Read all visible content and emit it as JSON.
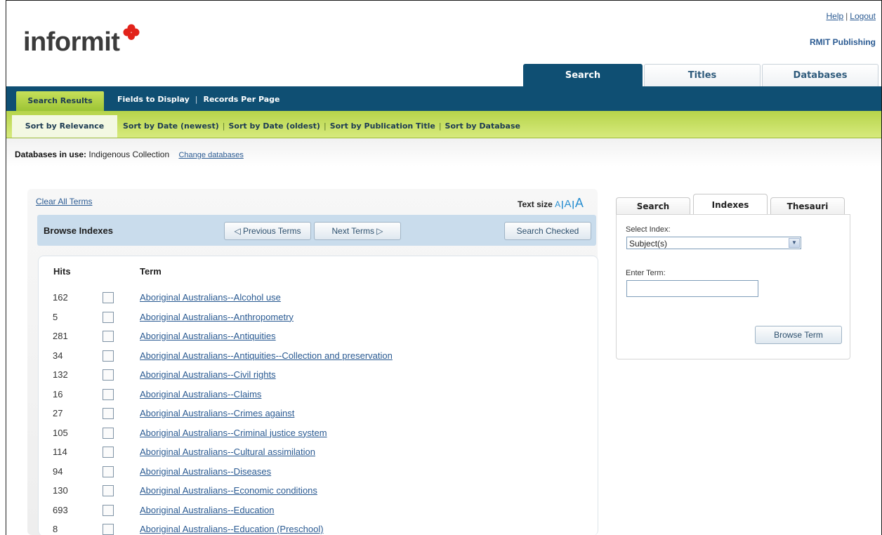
{
  "header": {
    "logo_text": "informit",
    "help": "Help",
    "logout": "Logout",
    "sep": "|",
    "publisher": "RMIT Publishing"
  },
  "main_tabs": [
    "Search",
    "Titles",
    "Databases"
  ],
  "nav": {
    "active": "Search Results",
    "fields": "Fields to Display",
    "records": "Records Per Page"
  },
  "sort": {
    "active": "Sort by Relevance",
    "date_newest": "Sort by Date (newest)",
    "date_oldest": "Sort by Date (oldest)",
    "pub_title": "Sort by Publication Title",
    "database": "Sort by Database"
  },
  "databases": {
    "label": "Databases in use:",
    "value": "Indigenous Collection",
    "change": "Change databases"
  },
  "browse": {
    "clear_terms": "Clear All Terms",
    "text_size_label": "Text size",
    "size_a": "A",
    "title": "Browse Indexes",
    "prev": "◁ Previous Terms",
    "next": "Next Terms ▷",
    "search_checked": "Search Checked",
    "col_hits": "Hits",
    "col_term": "Term",
    "rows": [
      {
        "hits": "162",
        "term": "Aboriginal Australians--Alcohol use"
      },
      {
        "hits": "5",
        "term": "Aboriginal Australians--Anthropometry"
      },
      {
        "hits": "281",
        "term": "Aboriginal Australians--Antiquities"
      },
      {
        "hits": "34",
        "term": "Aboriginal Australians--Antiquities--Collection and preservation"
      },
      {
        "hits": "132",
        "term": "Aboriginal Australians--Civil rights"
      },
      {
        "hits": "16",
        "term": "Aboriginal Australians--Claims"
      },
      {
        "hits": "27",
        "term": "Aboriginal Australians--Crimes against"
      },
      {
        "hits": "105",
        "term": "Aboriginal Australians--Criminal justice system"
      },
      {
        "hits": "114",
        "term": "Aboriginal Australians--Cultural assimilation"
      },
      {
        "hits": "94",
        "term": "Aboriginal Australians--Diseases"
      },
      {
        "hits": "130",
        "term": "Aboriginal Australians--Economic conditions"
      },
      {
        "hits": "693",
        "term": "Aboriginal Australians--Education"
      },
      {
        "hits": "8",
        "term": "Aboriginal Australians--Education (Preschool)"
      }
    ]
  },
  "side": {
    "tabs": [
      "Search",
      "Indexes",
      "Thesauri"
    ],
    "select_label": "Select Index:",
    "select_value": "Subject(s)",
    "term_label": "Enter Term:",
    "term_value": "",
    "browse_button": "Browse Term"
  },
  "colors": {
    "nav_blue": "#0f4f73",
    "lime": "#b6d44a",
    "link": "#2a5a92"
  }
}
